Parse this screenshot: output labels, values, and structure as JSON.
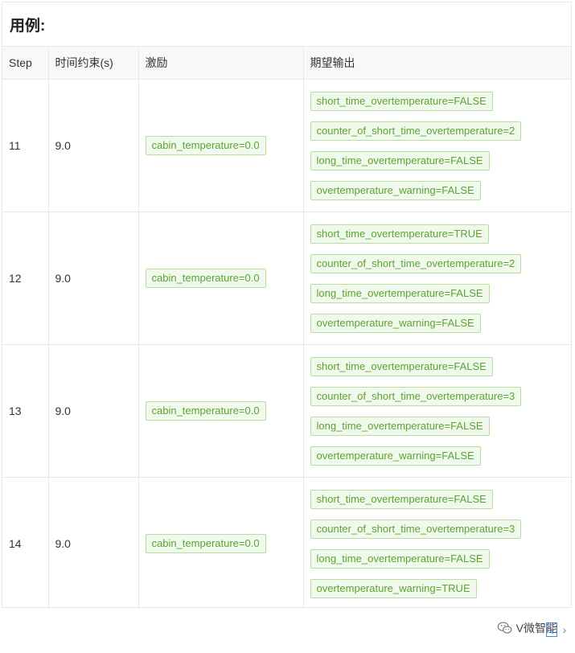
{
  "title": "用例:",
  "columns": [
    "Step",
    "时间约束(s)",
    "激励",
    "期望输出"
  ],
  "rows": [
    {
      "step": "11",
      "time": "9.0",
      "stimulus": "cabin_temperature=0.0",
      "outputs": [
        "short_time_overtemperature=FALSE",
        "counter_of_short_time_overtemperature=2",
        "long_time_overtemperature=FALSE",
        "overtemperature_warning=FALSE"
      ]
    },
    {
      "step": "12",
      "time": "9.0",
      "stimulus": "cabin_temperature=0.0",
      "outputs": [
        "short_time_overtemperature=TRUE",
        "counter_of_short_time_overtemperature=2",
        "long_time_overtemperature=FALSE",
        "overtemperature_warning=FALSE"
      ]
    },
    {
      "step": "13",
      "time": "9.0",
      "stimulus": "cabin_temperature=0.0",
      "outputs": [
        "short_time_overtemperature=FALSE",
        "counter_of_short_time_overtemperature=3",
        "long_time_overtemperature=FALSE",
        "overtemperature_warning=FALSE"
      ]
    },
    {
      "step": "14",
      "time": "9.0",
      "stimulus": "cabin_temperature=0.0",
      "outputs": [
        "short_time_overtemperature=FALSE",
        "counter_of_short_time_overtemperature=3",
        "long_time_overtemperature=FALSE",
        "overtemperature_warning=TRUE"
      ]
    }
  ],
  "watermark": {
    "text": "V微智能",
    "icon": "wechat-icon"
  },
  "nav": {
    "prev": "‹",
    "next": "›"
  },
  "colors": {
    "tag_border": "#b3e19d",
    "tag_background": "#f0f9eb",
    "tag_text": "#5ba432",
    "header_background": "#f8f8f8",
    "grid_line": "#e8e8e8"
  }
}
